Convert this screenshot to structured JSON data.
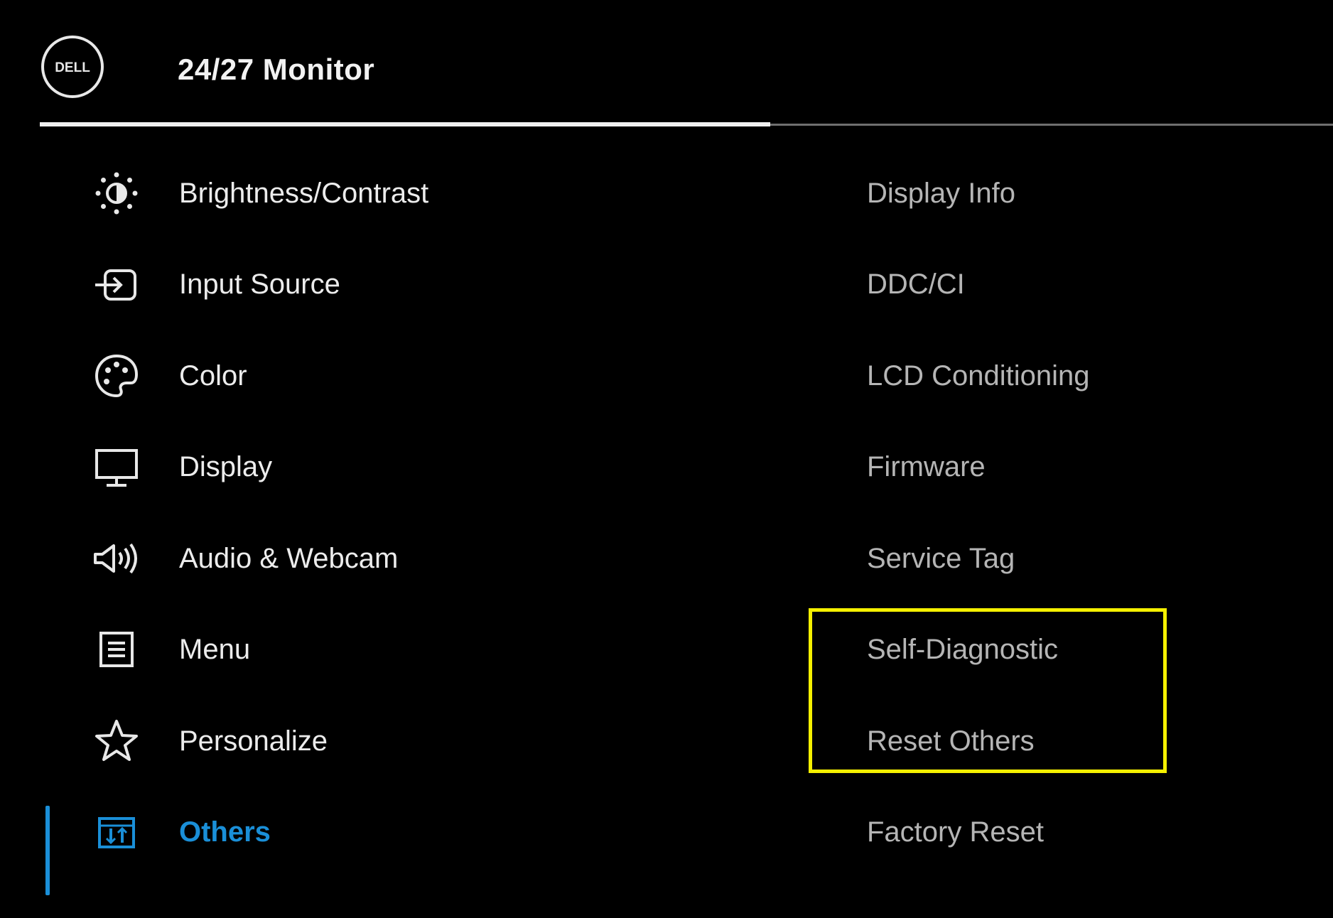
{
  "header": {
    "title": "24/27 Monitor",
    "logo_text": "DELL"
  },
  "menu": {
    "items": [
      {
        "label": "Brightness/Contrast",
        "icon": "brightness-icon"
      },
      {
        "label": "Input Source",
        "icon": "input-source-icon"
      },
      {
        "label": "Color",
        "icon": "palette-icon"
      },
      {
        "label": "Display",
        "icon": "monitor-icon"
      },
      {
        "label": "Audio & Webcam",
        "icon": "speaker-icon"
      },
      {
        "label": "Menu",
        "icon": "menu-list-icon"
      },
      {
        "label": "Personalize",
        "icon": "star-icon"
      },
      {
        "label": "Others",
        "icon": "others-icon",
        "active": true
      }
    ]
  },
  "submenu": {
    "items": [
      {
        "label": "Display Info"
      },
      {
        "label": "DDC/CI"
      },
      {
        "label": "LCD Conditioning"
      },
      {
        "label": "Firmware"
      },
      {
        "label": "Service Tag"
      },
      {
        "label": "Self-Diagnostic"
      },
      {
        "label": "Reset Others"
      },
      {
        "label": "Factory Reset"
      }
    ]
  },
  "colors": {
    "background": "#000000",
    "accent": "#1a8fd8",
    "highlight": "#f5f000",
    "text": "#ececec",
    "submenu_text": "#b5b5b5"
  }
}
